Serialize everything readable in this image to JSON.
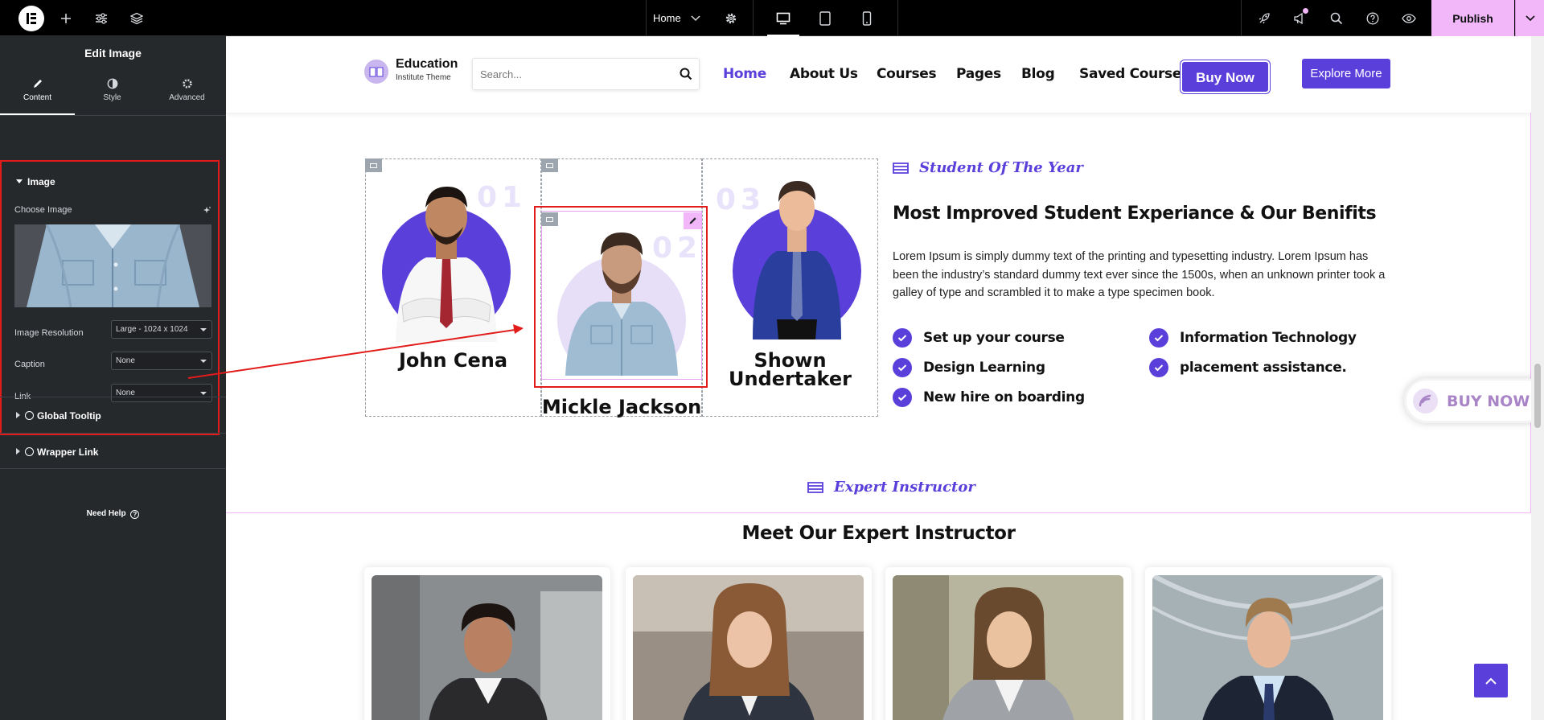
{
  "editor": {
    "page_selector": "Home",
    "publish_label": "Publish",
    "panel_title": "Edit Image",
    "tabs": [
      {
        "label": "Content",
        "active": true
      },
      {
        "label": "Style",
        "active": false
      },
      {
        "label": "Advanced",
        "active": false
      }
    ],
    "section_image": "Image",
    "choose_image_label": "Choose Image",
    "image_resolution_label": "Image Resolution",
    "image_resolution_value": "Large - 1024 x 1024",
    "caption_label": "Caption",
    "caption_value": "None",
    "link_label": "Link",
    "link_value": "None",
    "global_tooltip": "Global Tooltip",
    "wrapper_link": "Wrapper Link",
    "need_help": "Need Help",
    "accent_color": "#f1b7f8"
  },
  "site": {
    "logo_title": "Education",
    "logo_subtitle": "Institute Theme",
    "search_placeholder": "Search...",
    "nav": [
      "Home",
      "About Us",
      "Courses",
      "Pages",
      "Blog",
      "Saved Courses"
    ],
    "buy_now": "Buy Now",
    "explore_more": "Explore More",
    "brand_color": "#5b3fdb"
  },
  "students": [
    {
      "number": "01",
      "name": "John Cena"
    },
    {
      "number": "02",
      "name": "Mickle Jackson"
    },
    {
      "number": "03",
      "name": "Shown Undertaker"
    }
  ],
  "feature": {
    "kicker": "Student Of The Year",
    "heading": "Most Improved Student Experiance & Our Benifits",
    "paragraph": "Lorem Ipsum is simply dummy text of the printing and typesetting industry. Lorem Ipsum has been the industry’s standard dummy text ever since the 1500s, when an unknown printer took a galley of type and scrambled it to make a type specimen book.",
    "checklist": [
      "Set up your course",
      "Information Technology",
      "Design Learning",
      "placement assistance.",
      "New hire on boarding"
    ]
  },
  "floating_buy_now": "BUY NOW",
  "instructors": {
    "kicker": "Expert Instructor",
    "heading": "Meet Our Expert Instructor"
  }
}
